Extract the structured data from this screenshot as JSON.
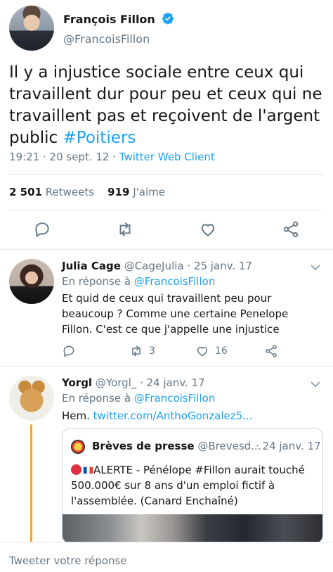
{
  "main_tweet": {
    "name": "François Fillon",
    "handle": "@FrancoisFillon",
    "text": "Il y a injustice sociale entre ceux qui travaillent dur pour peu et ceux qui ne travaillent pas et reçoivent de l'argent public ",
    "hashtag": "#Poitiers",
    "time": "19:21 · 20 sept. 12 · ",
    "client": "Twitter Web Client",
    "retweets_count": "2 501",
    "retweets_label": "Retweets",
    "likes_count": "919",
    "likes_label": "J'aime",
    "icons": [
      "reply-icon",
      "retweet-icon",
      "like-icon",
      "share-icon"
    ],
    "colors": {
      "link": "#1da1f2",
      "verified": "#1da1f2"
    }
  },
  "replies": [
    {
      "name": "Julia Cage",
      "handle": "@CageJulia",
      "date": "· 25 janv. 17",
      "reply_to_prefix": "En réponse à ",
      "reply_to": "@FrancoisFillon",
      "text": "Et quid de ceux qui travaillent peu pour beaucoup ? Comme une certaine Penelope Fillon. C'est ce que j'appelle une injustice",
      "retweets": "3",
      "likes": "16"
    },
    {
      "name": "Yorgl",
      "handle": "@Yorgl_",
      "date": "· 24 janv. 17",
      "reply_to_prefix": "En réponse à ",
      "reply_to": "@FrancoisFillon",
      "text_prefix": "Hem. ",
      "link": "twitter.com/AnthoGonzalez5...",
      "quote": {
        "name": "Brèves de presse",
        "handle": "@Brevesd...",
        "date": "· 24 janv. 17",
        "text": "ALERTE - Pénélope #Fillon aurait touché 500.000€ sur 8 ans d'un emploi fictif à l'assemblée. (Canard Enchaîné)"
      }
    }
  ],
  "compose": {
    "placeholder": "Tweeter votre réponse"
  }
}
